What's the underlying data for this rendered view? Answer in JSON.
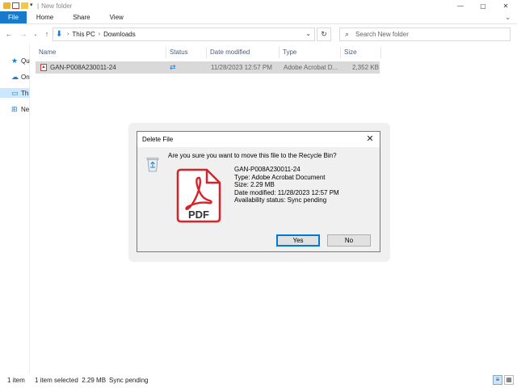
{
  "window": {
    "title": "New folder",
    "controls": {
      "minimize": "—",
      "maximize": "▢",
      "close": "✕"
    }
  },
  "ribbon": {
    "tabs": [
      {
        "label": "File"
      },
      {
        "label": "Home"
      },
      {
        "label": "Share"
      },
      {
        "label": "View"
      }
    ]
  },
  "address": {
    "crumbs": [
      "This PC",
      "Downloads"
    ],
    "search_placeholder": "Search New folder"
  },
  "navpane": {
    "items": [
      {
        "label": "Qu",
        "icon": "star-icon",
        "color": "#1d7bd6"
      },
      {
        "label": "On",
        "icon": "cloud-icon",
        "color": "#1d7bd6"
      },
      {
        "label": "Th",
        "icon": "computer-icon",
        "color": "#1d7bd6"
      },
      {
        "label": "Ne",
        "icon": "network-icon",
        "color": "#1d7bd6"
      }
    ]
  },
  "list": {
    "columns": [
      "Name",
      "Status",
      "Date modified",
      "Type",
      "Size"
    ],
    "rows": [
      {
        "name": "GAN-P008A230011-24",
        "status_icon": "sync-icon",
        "date": "11/28/2023 12:57 PM",
        "type": "Adobe Acrobat D...",
        "size": "2,352 KB"
      }
    ]
  },
  "statusbar": {
    "count": "1 item",
    "selected": "1 item selected  2.29 MB",
    "sync": "Sync pending"
  },
  "dialog": {
    "title": "Delete File",
    "question": "Are you sure you want to move this file to the Recycle Bin?",
    "pdf_label": "PDF",
    "file_name": "GAN-P008A230011-24",
    "type_line": "Type: Adobe Acrobat Document",
    "size_line": "Size: 2.29 MB",
    "date_line": "Date modified: 11/28/2023 12:57 PM",
    "availability_line": "Availability status: Sync pending",
    "yes_label": "Yes",
    "no_label": "No"
  },
  "colors": {
    "accent": "#1979ca",
    "selection": "#cce8ff",
    "pdf_red": "#d8232a"
  }
}
